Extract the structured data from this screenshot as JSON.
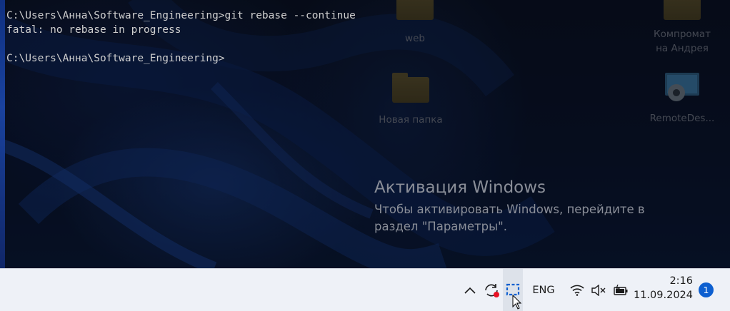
{
  "terminal": {
    "lines": [
      "C:\\Users\\Анна\\Software_Engineering>git rebase --continue",
      "fatal: no rebase in progress",
      "",
      "C:\\Users\\Анна\\Software_Engineering>"
    ]
  },
  "desktop_icons": [
    {
      "label": "web",
      "icon": "folder-icon"
    },
    {
      "label": "Новая папка",
      "icon": "folder-icon"
    },
    {
      "label": "Компромат на Андрея",
      "label_line1": "Компромат",
      "label_line2": "на Андрея",
      "icon": "folder-icon"
    },
    {
      "label": "RemoteDes...",
      "icon": "remote-desktop-icon"
    }
  ],
  "activation": {
    "title": "Активация Windows",
    "text": "Чтобы активировать Windows, перейдите в раздел \"Параметры\"."
  },
  "taskbar": {
    "tray_icons": [
      "chevron-up-icon",
      "sync-icon",
      "snipping-tool-icon",
      "wifi-icon",
      "volume-muted-icon",
      "battery-icon"
    ],
    "language": "ENG",
    "time": "2:16",
    "date": "11.09.2024",
    "notification_count": "1",
    "accent": "#0d5fd0",
    "record_dot_color": "#e81123"
  }
}
